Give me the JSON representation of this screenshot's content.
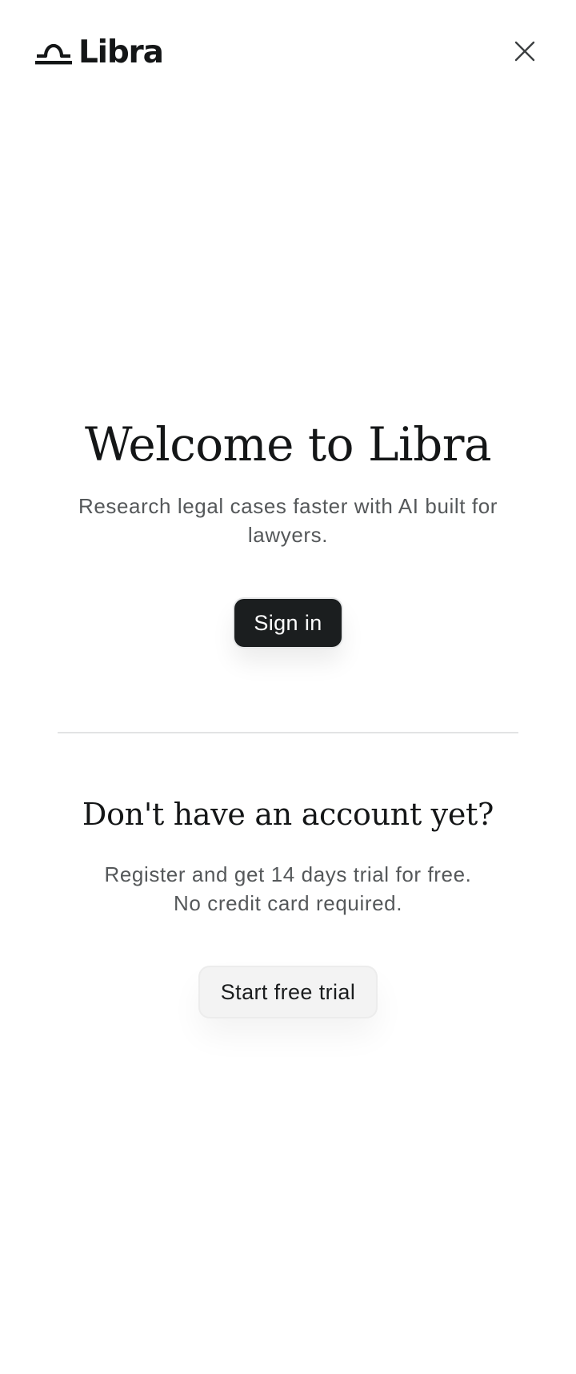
{
  "header": {
    "logo_text": "Libra",
    "logo_icon": "libra-scale-icon",
    "close_icon": "close-icon"
  },
  "welcome": {
    "title": "Welcome to Libra",
    "subtitle": "Research legal cases faster with AI built for lawyers.",
    "sign_in_label": "Sign in"
  },
  "register": {
    "heading": "Don't have an account yet?",
    "line1": "Register and get 14 days trial for free.",
    "line2": "No credit card required.",
    "trial_label": "Start free trial"
  },
  "colors": {
    "primary_button": "#1b1e1f",
    "secondary_button": "#f3f3f3",
    "text_muted": "#55585a",
    "divider": "#e2e3e4"
  }
}
